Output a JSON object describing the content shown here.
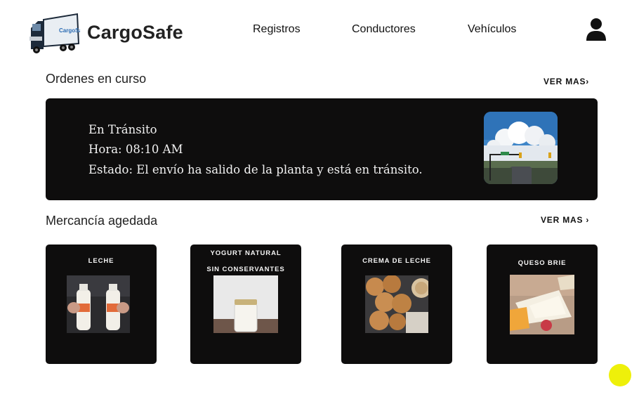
{
  "header": {
    "brand": "CargoSafe",
    "logo_text": "CargoSafe",
    "nav": [
      "Registros",
      "Conductores",
      "Vehículos"
    ],
    "user_icon": "user-icon"
  },
  "orders": {
    "title": "Ordenes en curso",
    "ver_mas": "VER MAS›",
    "card": {
      "status": "En Tránsito",
      "time": "Hora: 08:10 AM",
      "state": "Estado: El envío ha salido de la planta y está en tránsito."
    }
  },
  "merch": {
    "title": "Mercancía agedada",
    "ver_mas": "VER MAS ›",
    "items": [
      {
        "lines": [
          "LECHE"
        ]
      },
      {
        "lines": [
          "YOGURT NATURAL",
          "SIN CONSERVANTES"
        ]
      },
      {
        "lines": [
          "CREMA DE LECHE"
        ]
      },
      {
        "lines": [
          "QUESO BRIE"
        ]
      }
    ]
  },
  "colors": {
    "card_bg": "#0e0d0d",
    "fab": "#eef00a",
    "text": "#1a1a1a"
  }
}
